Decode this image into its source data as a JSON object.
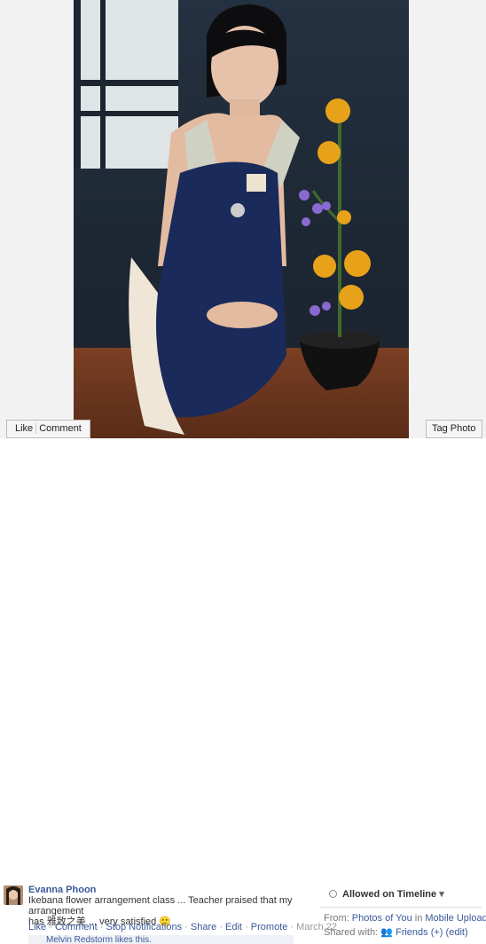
{
  "photo": {
    "like_label": "Like",
    "comment_label": "Comment",
    "tag_label": "Tag Photo"
  },
  "post": {
    "author": "Evanna Phoon",
    "caption_line1": "Ikebana flower arrangement class ... Teacher praised that my arrangement",
    "caption_line2": "has 雅致之美 ... very satisfied 🙂",
    "actions": {
      "like": "Like",
      "comment": "Comment",
      "stop_notifications": "Stop Notifications",
      "share": "Share",
      "edit": "Edit",
      "promote": "Promote",
      "date": "March 22"
    },
    "likes_text": "Melvin Redstorm likes this."
  },
  "sidebar": {
    "allowed_label": "Allowed on Timeline",
    "from_label": "From:",
    "from_album": "Photos of You",
    "from_in": "in",
    "from_source": "Mobile Uploads",
    "shared_label": "Shared with:",
    "shared_value": "Friends (+)",
    "edit_label": "(edit)"
  },
  "colors": {
    "link": "#3b5998",
    "muted": "#999999"
  }
}
